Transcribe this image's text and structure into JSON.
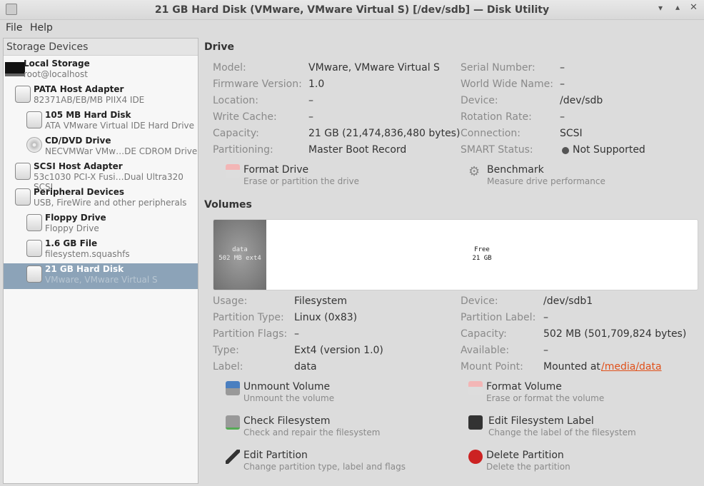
{
  "window": {
    "title": "21 GB Hard Disk (VMware, VMware Virtual S) [/dev/sdb] — Disk Utility"
  },
  "menu": [
    "File",
    "Help"
  ],
  "sidebar": {
    "header": "Storage Devices",
    "items": [
      {
        "title": "Local Storage",
        "sub": "root@localhost",
        "icon": "monitor-icon"
      },
      {
        "title": "PATA Host Adapter",
        "sub": "82371AB/EB/MB PIIX4 IDE",
        "icon": "adapter-icon"
      },
      {
        "title": "105 MB Hard Disk",
        "sub": "ATA VMware Virtual IDE Hard Drive",
        "icon": "hard-disk-icon"
      },
      {
        "title": "CD/DVD Drive",
        "sub": "NECVMWar VMw…DE CDROM Drive",
        "icon": "optical-disc-icon"
      },
      {
        "title": "SCSI Host Adapter",
        "sub": "53c1030 PCI-X Fusi…Dual Ultra320 SCSI",
        "icon": "adapter-icon"
      },
      {
        "title": "Peripheral Devices",
        "sub": "USB, FireWire and other peripherals",
        "icon": "usb-icon"
      },
      {
        "title": "Floppy Drive",
        "sub": "Floppy Drive",
        "icon": "drive-icon"
      },
      {
        "title": "1.6 GB File",
        "sub": "filesystem.squashfs",
        "icon": "drive-icon"
      },
      {
        "title": "21 GB Hard Disk",
        "sub": "VMware, VMware Virtual S",
        "icon": "hard-disk-icon"
      }
    ]
  },
  "drive": {
    "heading": "Drive",
    "left": [
      [
        "Model:",
        "VMware, VMware Virtual S"
      ],
      [
        "Firmware Version:",
        "1.0"
      ],
      [
        "Location:",
        "–"
      ],
      [
        "Write Cache:",
        "–"
      ],
      [
        "Capacity:",
        "21 GB (21,474,836,480 bytes)"
      ],
      [
        "Partitioning:",
        "Master Boot Record"
      ]
    ],
    "right": [
      [
        "Serial Number:",
        "–"
      ],
      [
        "World Wide Name:",
        "–"
      ],
      [
        "Device:",
        "/dev/sdb"
      ],
      [
        "Rotation Rate:",
        "–"
      ],
      [
        "Connection:",
        "SCSI"
      ],
      [
        "SMART Status:",
        "Not Supported"
      ]
    ],
    "actions": [
      {
        "title": "Format Drive",
        "sub": "Erase or partition the drive"
      },
      {
        "title": "Benchmark",
        "sub": "Measure drive performance"
      }
    ]
  },
  "volumes": {
    "heading": "Volumes",
    "segments": [
      {
        "name": "data",
        "info": "502 MB ext4"
      },
      {
        "name": "Free",
        "info": "21 GB"
      }
    ],
    "left": [
      [
        "Usage:",
        "Filesystem"
      ],
      [
        "Partition Type:",
        "Linux (0x83)"
      ],
      [
        "Partition Flags:",
        "–"
      ],
      [
        "Type:",
        "Ext4 (version 1.0)"
      ],
      [
        "Label:",
        "data"
      ]
    ],
    "right": [
      [
        "Device:",
        "/dev/sdb1"
      ],
      [
        "Partition Label:",
        "–"
      ],
      [
        "Capacity:",
        "502 MB (501,709,824 bytes)"
      ],
      [
        "Available:",
        "–"
      ],
      [
        "Mount Point:",
        "Mounted at"
      ]
    ],
    "mount_link": "/media/data",
    "actions": [
      {
        "title": "Unmount Volume",
        "sub": "Unmount the volume"
      },
      {
        "title": "Format Volume",
        "sub": "Erase or format the volume"
      },
      {
        "title": "Check Filesystem",
        "sub": "Check and repair the filesystem"
      },
      {
        "title": "Edit Filesystem Label",
        "sub": "Change the label of the filesystem"
      },
      {
        "title": "Edit Partition",
        "sub": "Change partition type, label and flags"
      },
      {
        "title": "Delete Partition",
        "sub": "Delete the partition"
      }
    ]
  }
}
